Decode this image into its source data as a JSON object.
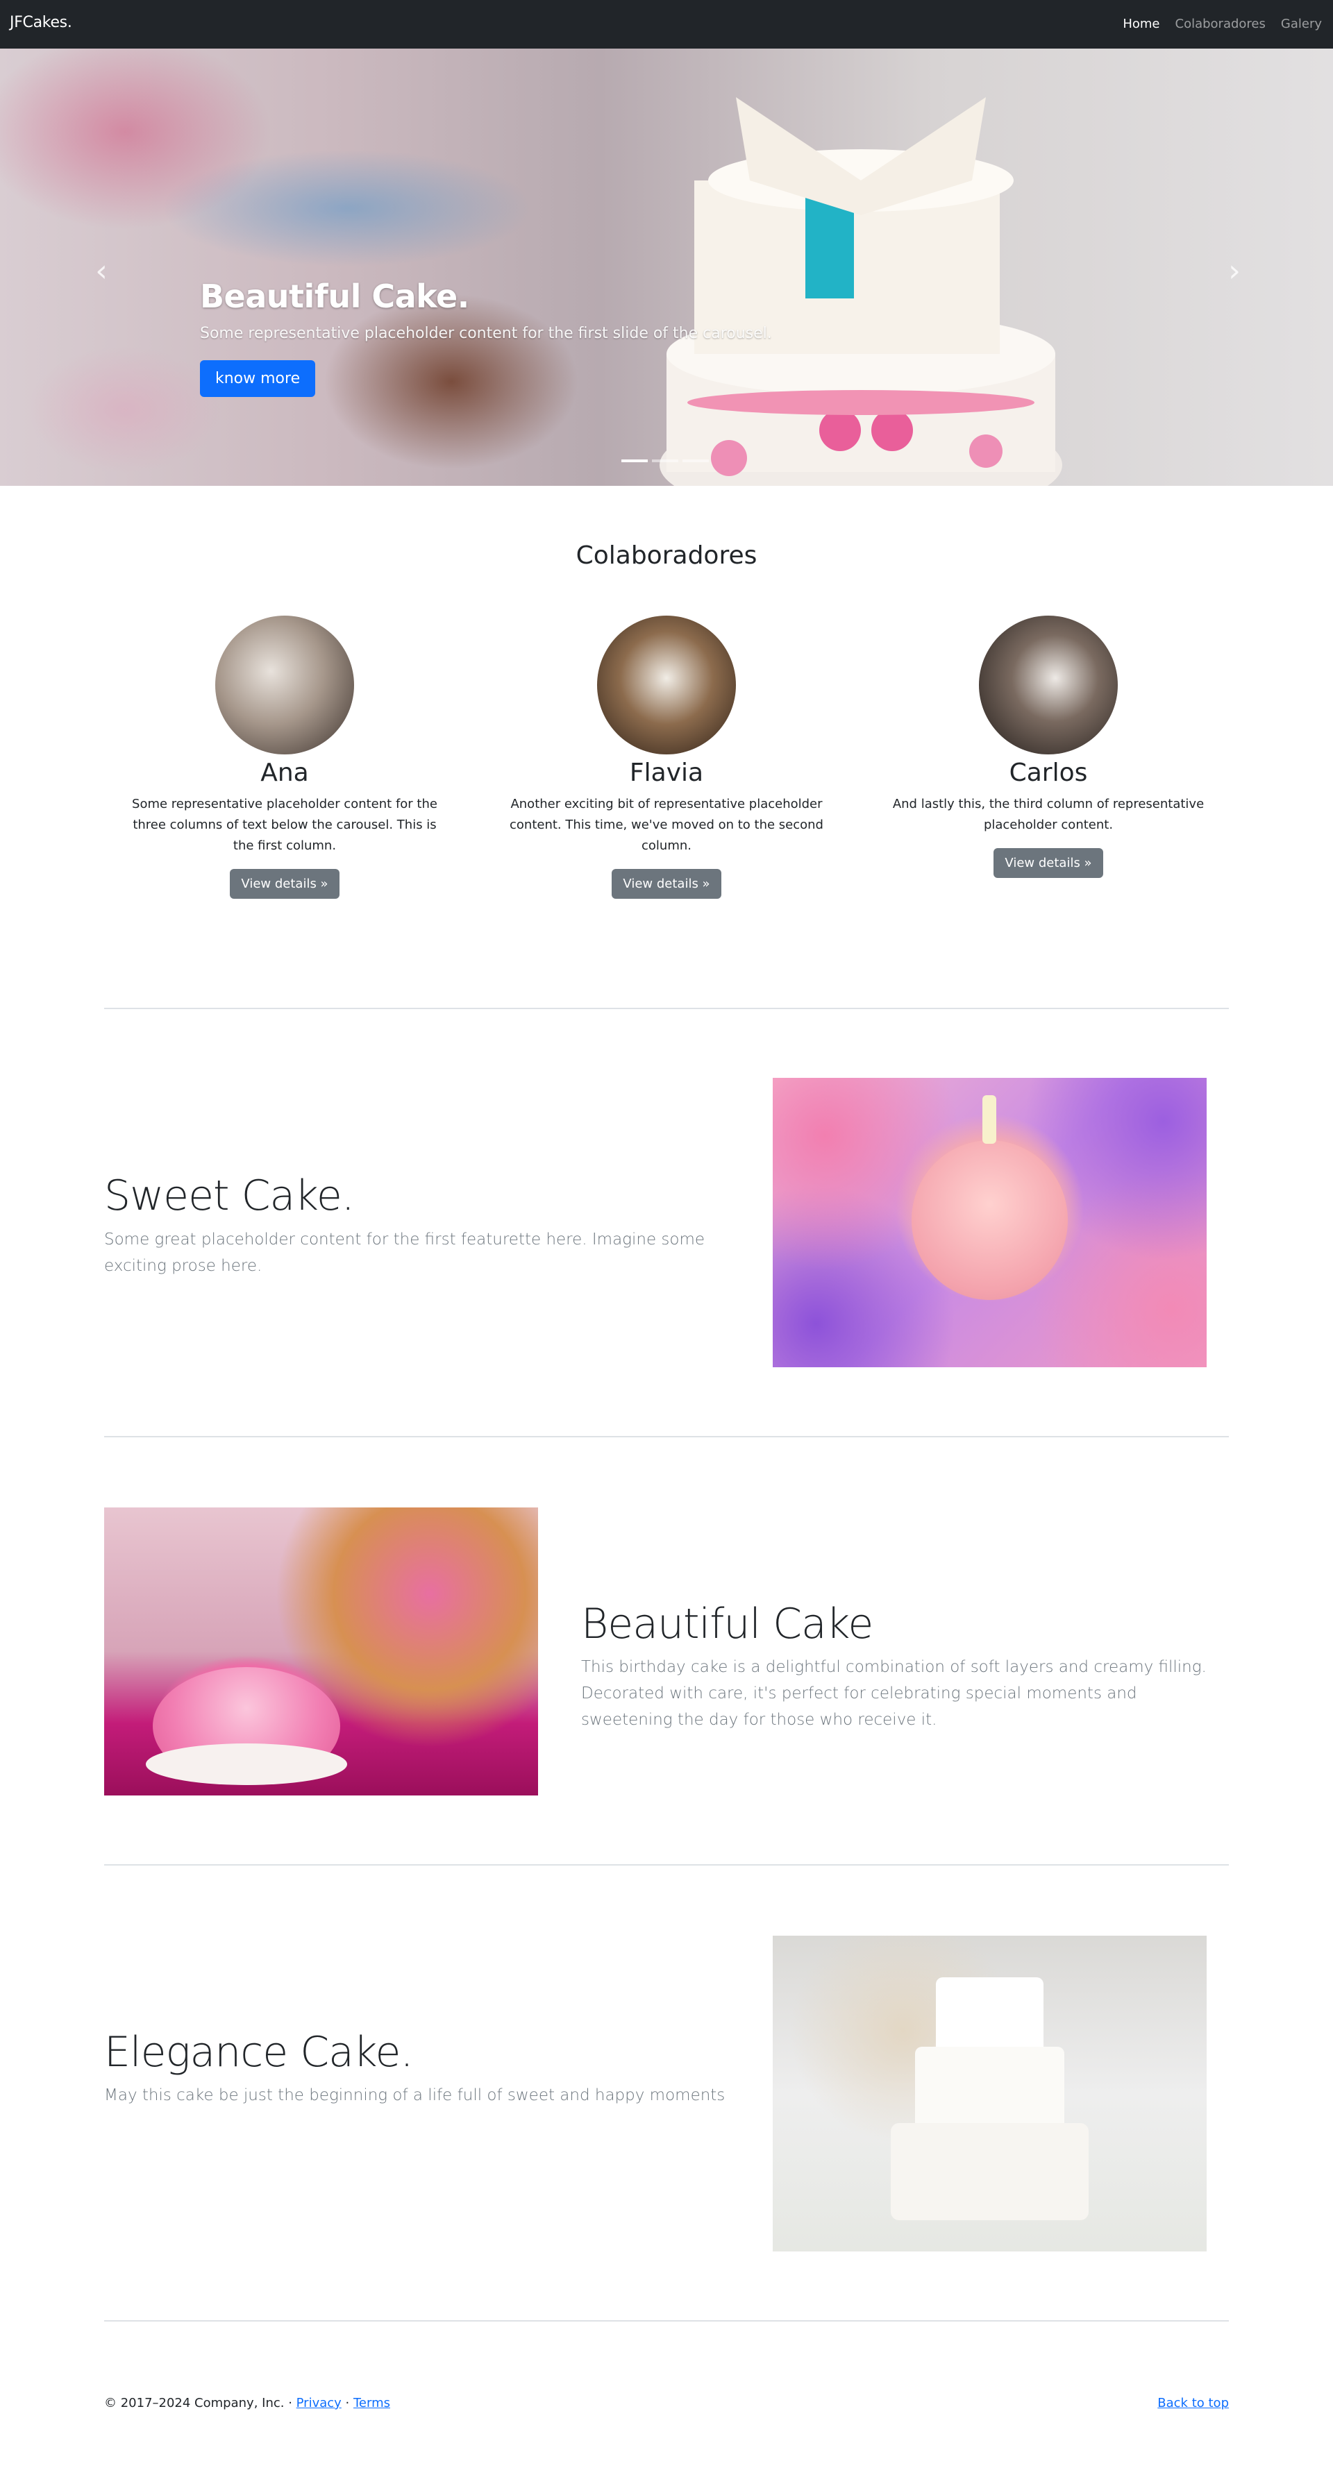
{
  "navbar": {
    "brand": "JFCakes.",
    "links": [
      {
        "label": "Home",
        "active": true
      },
      {
        "label": "Colaboradores",
        "active": false
      },
      {
        "label": "Galery",
        "active": false
      }
    ]
  },
  "carousel": {
    "title": "Beautiful Cake.",
    "text": "Some representative placeholder content for the first slide of the carousel.",
    "button": "know more",
    "slide_count": 3,
    "active_slide": 1
  },
  "collaborators": {
    "heading": "Colaboradores",
    "people": [
      {
        "name": "Ana",
        "text": "Some representative placeholder content for the three columns of text below the carousel. This is the first column.",
        "button": "View details »"
      },
      {
        "name": "Flavia",
        "text": "Another exciting bit of representative placeholder content. This time, we've moved on to the second column.",
        "button": "View details »"
      },
      {
        "name": "Carlos",
        "text": "And lastly this, the third column of representative placeholder content.",
        "button": "View details »"
      }
    ]
  },
  "featurettes": [
    {
      "heading": "Sweet Cake.",
      "text": "Some great placeholder content for the first featurette here. Imagine some exciting prose here."
    },
    {
      "heading": "Beautiful Cake",
      "text": "This birthday cake is a delightful combination of soft layers and creamy filling. Decorated with care, it's perfect for celebrating special moments and sweetening the day for those who receive it."
    },
    {
      "heading": "Elegance Cake.",
      "text": "May this cake be just the beginning of a life full of sweet and happy moments"
    }
  ],
  "footer": {
    "copyright": "© 2017–2024 Company, Inc. · ",
    "privacy": "Privacy",
    "separator": " · ",
    "terms": "Terms",
    "back_to_top": "Back to top"
  },
  "colors": {
    "navbar_bg": "#212529",
    "primary": "#0d6efd",
    "secondary": "#6c757d",
    "divider": "#dee2e6"
  }
}
